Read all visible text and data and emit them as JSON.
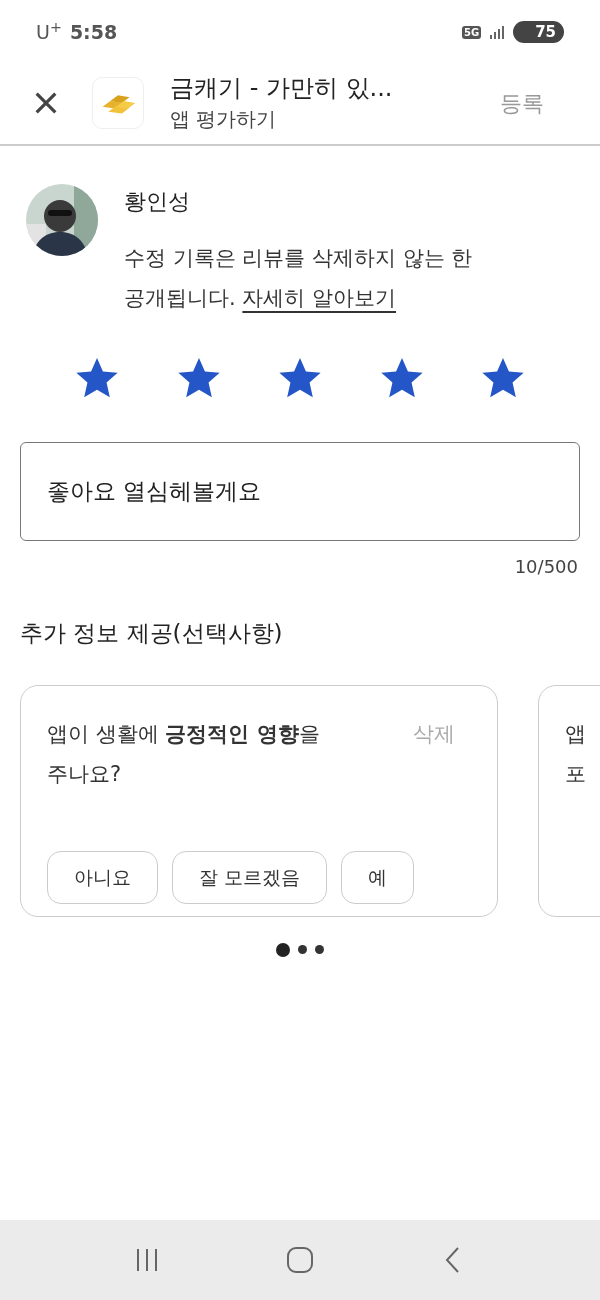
{
  "status_bar": {
    "carrier": "U$^{+}$",
    "time": "5:58",
    "network": "5G",
    "battery": "75"
  },
  "header": {
    "title": "금캐기 - 가만히 있...",
    "subtitle": "앱 평가하기",
    "submit": "등록"
  },
  "reviewer": {
    "name": "황인성",
    "notice": "수정 기록은 리뷰를 삭제하지 않는 한 공개됩니다.",
    "link": "자세히 알아보기"
  },
  "rating": {
    "stars": 5
  },
  "review": {
    "value": "좋아요 열심헤볼게요",
    "counter": "10/500"
  },
  "extra": {
    "title": "추가 정보 제공(선택사항)",
    "cards": [
      {
        "lines": [
          "앱이 생활에 **긍정적인 영향**을",
          "주나요?"
        ],
        "delete": "삭제",
        "buttons": [
          "아니요",
          "잘 모르겠음",
          "예"
        ]
      },
      {
        "lines": [
          "앱",
          "포"
        ]
      }
    ],
    "dots": [
      {
        "selected": true
      },
      {
        "selected": false
      },
      {
        "selected": false
      }
    ]
  }
}
